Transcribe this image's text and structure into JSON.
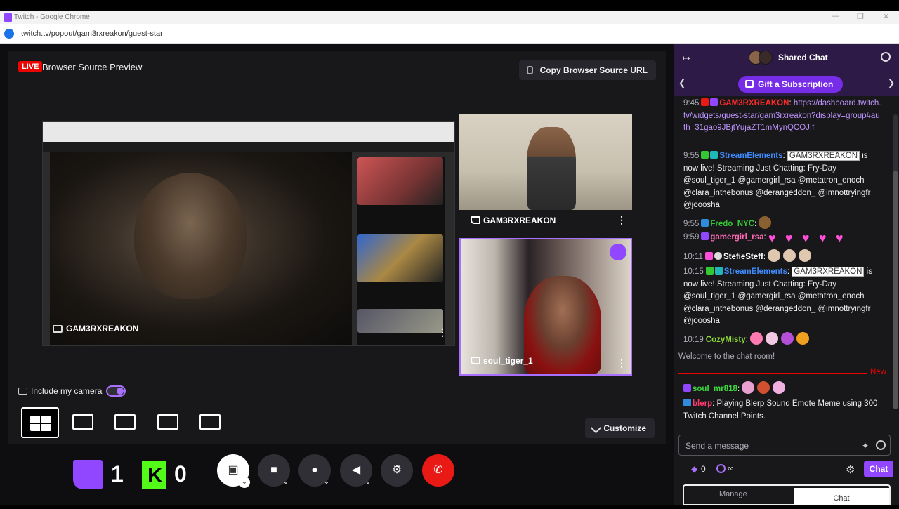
{
  "browser": {
    "window_title": "Twitch - Google Chrome",
    "url": "twitch.tv/popout/gam3rxreakon/guest-star"
  },
  "preview": {
    "live_badge": "LIVE",
    "title": "Browser Source Preview",
    "copy_url_label": "Copy Browser Source URL",
    "tiles": [
      {
        "name": "GAM3RXREAKON"
      },
      {
        "name": "GAM3RXREAKON"
      },
      {
        "name": "soul_tiger_1"
      }
    ],
    "include_camera_label": "Include my camera",
    "include_camera_on": true,
    "customize_label": "Customize"
  },
  "stats": {
    "twitch_viewers": "1",
    "kick_viewers": "0"
  },
  "chat": {
    "header_title": "Shared Chat",
    "gift_label": "Gift a Subscription",
    "messages": [
      {
        "time": "9:45",
        "user": "GAM3RXREAKON",
        "user_color": "#ff2a2a",
        "text": "https://dashboard.twitch.tv/widgets/guest-star/gam3rxreakon?display=group#auth=31gao9JBjtYujaZT1mMynQCOJIf"
      },
      {
        "time": "9:55",
        "user": "StreamElements",
        "user_color": "#3f8cff",
        "mention": "GAM3RXREAKON",
        "text": "is now live! Streaming Just Chatting: Fry-Day @soul_tiger_1 @gamergirl_rsa @metatron_enoch @clara_inthebonus @derangeddon_ @imnottryingfr @jooosha"
      },
      {
        "time": "9:55",
        "user": "Fredo_NYC",
        "user_color": "#35c835",
        "text": ""
      },
      {
        "time": "9:59",
        "user": "gamergirl_rsa",
        "user_color": "#ff69b4",
        "text": ""
      },
      {
        "time": "10:11",
        "user": "StefieSteff",
        "user_color": "#ffffff",
        "text": ""
      },
      {
        "time": "10:15",
        "user": "StreamElements",
        "user_color": "#3f8cff",
        "mention": "GAM3RXREAKON",
        "text": "is now live! Streaming Just Chatting: Fry-Day @soul_tiger_1 @gamergirl_rsa @metatron_enoch @clara_inthebonus @derangeddon_ @imnottryingfr @jooosha"
      },
      {
        "time": "10:19",
        "user": "CozyMisty",
        "user_color": "#8fdc38",
        "text": ""
      },
      {
        "time": "",
        "user": "soul_mr818",
        "user_color": "#3dd63d",
        "text": ""
      },
      {
        "time": "",
        "user": "blerp",
        "user_color": "#ff3a6e",
        "text": "Playing Blerp Sound Emote Meme using 300 Twitch Channel Points."
      }
    ],
    "welcome": "Welcome to the chat room!",
    "new_label": "New",
    "input_placeholder": "Send a message",
    "points": "0",
    "points_inf": "∞",
    "chat_button": "Chat",
    "tab_manage": "Manage",
    "tab_chat": "Chat"
  }
}
